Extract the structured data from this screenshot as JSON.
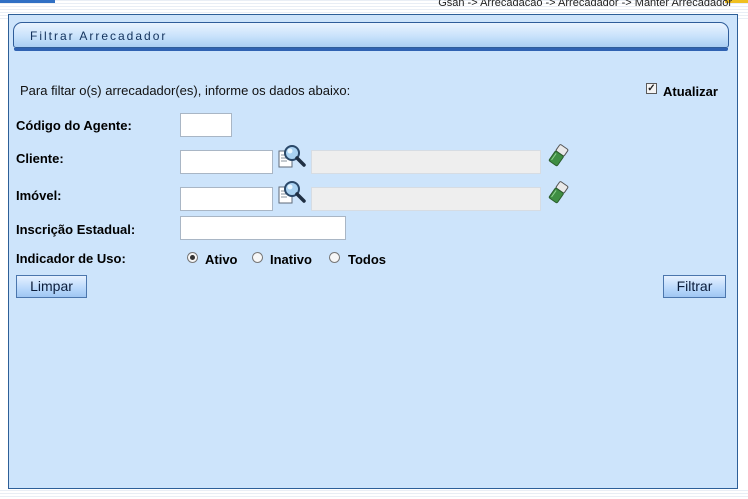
{
  "breadcrumb": "Gsan -> Arrecadacao -> Arrecadador -> Manter Arrecadador",
  "panel": {
    "title": "Filtrar Arrecadador",
    "intro": "Para filtar o(s) arrecadador(es), informe os dados abaixo:"
  },
  "atualizar": {
    "label": "Atualizar",
    "checked": true
  },
  "fields": {
    "codigo_agente": {
      "label": "Código do Agente:",
      "value": ""
    },
    "cliente": {
      "label": "Cliente:",
      "value": "",
      "description": ""
    },
    "imovel": {
      "label": "Imóvel:",
      "value": "",
      "description": ""
    },
    "inscricao_estadual": {
      "label": "Inscrição Estadual:",
      "value": ""
    },
    "indicador_uso": {
      "label": "Indicador de Uso:",
      "options": [
        "Ativo",
        "Inativo",
        "Todos"
      ],
      "selected": "Ativo"
    }
  },
  "buttons": {
    "limpar": "Limpar",
    "filtrar": "Filtrar"
  },
  "icons": {
    "search": "magnifier-icon",
    "clear": "eraser-icon"
  },
  "colors": {
    "panel_bg": "#cde4fb",
    "border": "#2d5f98",
    "header_bar": "#2f62b2"
  }
}
